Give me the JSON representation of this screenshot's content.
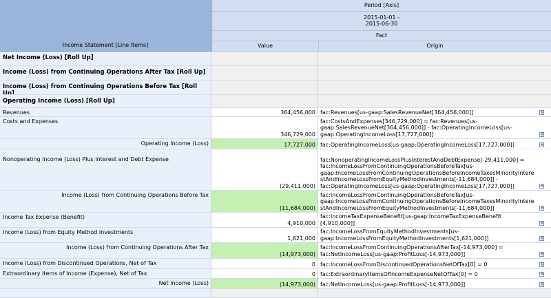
{
  "header": {
    "period_axis": "Period [Axis]",
    "date_range": "2015-01-01 -\n2015-06-30",
    "fact": "Fact",
    "line_items": "Income Statement [Line Items]",
    "value": "Value",
    "origin": "Origin"
  },
  "rows": [
    {
      "label": "Net Income (Loss) [Roll Up]",
      "value": "",
      "origin": ""
    },
    {
      "label": "Income (Loss) from Continuing Operations After Tax [Roll Up]",
      "value": "",
      "origin": ""
    },
    {
      "label": "Income (Loss) from Continuing Operations Before Tax [Roll Up]",
      "value": "",
      "origin": ""
    },
    {
      "label": "Operating Income (Loss) [Roll Up]",
      "value": "",
      "origin": ""
    },
    {
      "label": "Revenues",
      "value": "364,456,000",
      "origin": "fac:Revenues[us-gaap:SalesRevenueNet[364,456,000]]"
    },
    {
      "label": "Costs and Expenses",
      "value": "346,729,000",
      "origin": "fac:CostsAndExpenses[346,729,000] = fac:Revenues[us-\ngaap:SalesRevenueNet[364,456,000]] - fac:OperatingIncomeLoss[us-\ngaap:OperatingIncomeLoss[17,727,000]]"
    },
    {
      "label": "Operating Income (Loss)",
      "value": "17,727,000",
      "origin": "fac:OperatingIncomeLoss[us-gaap:OperatingIncomeLoss[17,727,000]]"
    },
    {
      "label": "Nonoperating Income (Loss) Plus Interest and Debt Expense",
      "value": "(29,411,000)",
      "origin": "fac:NonoperatingIncomeLossPlusInterestAndDebtExpense[-29,411,000] =\nfac:IncomeLossFromContinuingOperationsBeforeTax[us-\ngaap:IncomeLossFromContinuingOperationsBeforeIncomeTaxesMinorityIntere\nstAndIncomeLossFromEquityMethodInvestments[-11,684,000]] -\nfac:OperatingIncomeLoss[us-gaap:OperatingIncomeLoss[17,727,000]]"
    },
    {
      "label": "Income (Loss) from Continuing Operations Before Tax",
      "value": "(11,684,000)",
      "origin": "fac:IncomeLossFromContinuingOperationsBeforeTax[us-\ngaap:IncomeLossFromContinuingOperationsBeforeIncomeTaxesMinorityIntere\nstAndIncomeLossFromEquityMethodInvestments[-11,684,000]]"
    },
    {
      "label": "Income Tax Expense (Benefit)",
      "value": "4,910,000",
      "origin": "fac:IncomeTaxExpenseBenefit[us-gaap:IncomeTaxExpenseBenefit\n[4,910,000]]"
    },
    {
      "label": "Income (Loss) from Equity Method Investments",
      "value": "1,621,000",
      "origin": "fac:IncomeLossFromEquityMethodInvestments[us-\ngaap:IncomeLossFromEquityMethodInvestments[1,621,000]]"
    },
    {
      "label": "Income (Loss) from Continuing Operations After Tax",
      "value": "(14,973,000)",
      "origin": "fac:IncomeLossFromContinuingOperationsAfterTax[-14,973,000] =\nfac:NetIncomeLoss[us-gaap:ProfitLoss[-14,973,000]]"
    },
    {
      "label": "Income (Loss) from Discontinued Operations, Net of Tax",
      "value": "0",
      "origin": "fac:IncomeLossFromDiscontinuedOperationsNetOfTax[0] = 0"
    },
    {
      "label": "Extraordinary Items of Income (Expense), Net of Tax",
      "value": "0",
      "origin": "fac:ExtraordinaryItemsOfIncomeExpenseNetOfTax[0] = 0"
    },
    {
      "label": "Net Income (Loss)",
      "value": "(14,973,000)",
      "origin": "fac:NetIncomeLoss[us-gaap:ProfitLoss[-14,973,000]]"
    }
  ],
  "expand_symbol": "+"
}
